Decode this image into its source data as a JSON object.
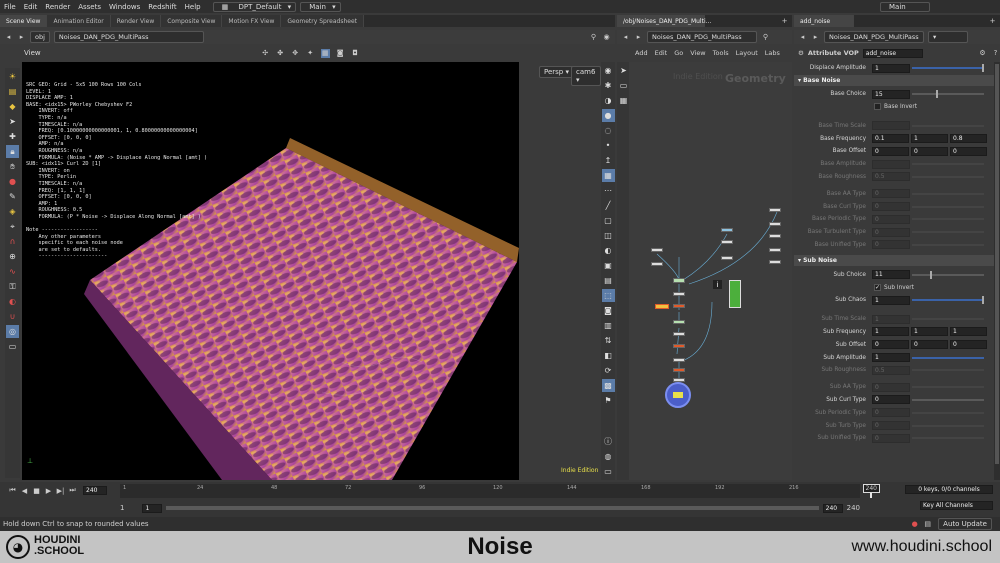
{
  "menu": [
    "File",
    "Edit",
    "Render",
    "Assets",
    "Windows",
    "Redshift",
    "Help"
  ],
  "desktop": {
    "name": "DPT_Default",
    "main": "Main"
  },
  "top_right_main": "Main",
  "left_tabs": [
    "Scene View",
    "Animation Editor",
    "Render View",
    "Composite View",
    "Motion FX View",
    "Geometry Spreadsheet"
  ],
  "left_path": {
    "obj": "obj",
    "node": "Noises_DAN_PDG_MultiPass"
  },
  "view_label": "View",
  "viewport": {
    "camera": "Persp",
    "cam_menu": "cam6",
    "watermark": "Indie Edition",
    "info_lines": [
      "SRC GEO: Grid - 5x5 100 Rows 100 Cols",
      "LEVEL: 1",
      "DISPLACE AMP: 1",
      "BASE: <idx15> PWorley Chebyshev F2",
      "    INVERT: off",
      "    TYPE: n/a",
      "    TIMESCALE: n/a",
      "    FREQ: [0.10000000000000001, 1, 0.80000000000000004]",
      "    OFFSET: [0, 0, 0]",
      "    AMP: n/a",
      "    ROUGHNESS: n/a",
      "    FORMULA: (Noise * AMP -> Displace Along Normal [amt] )",
      "SUB: <idx11> Curl 2D [1]",
      "    INVERT: on",
      "    TYPE: Perlin",
      "    TIMESCALE: n/a",
      "    FREQ: [1, 1, 1]",
      "    OFFSET: [0, 0, 0]",
      "    AMP: 1",
      "    ROUGHNESS: 0.5",
      "    FORMULA: (P * Noise -> Displace Along Normal [amt] )",
      "",
      "Note ------------------",
      "    Any other parameters",
      "    specific to each noise node",
      "    are set to defaults.",
      "    ----------------------"
    ]
  },
  "network": {
    "tab": "/obj/Noises_DAN_PDG_Multi...",
    "path_node": "Noises_DAN_PDG_MultiPass",
    "menu": [
      "Add",
      "Edit",
      "Go",
      "View",
      "Tools",
      "Layout",
      "Labs"
    ],
    "context_label": "Geometry",
    "watermark": "Indie Edition"
  },
  "parms": {
    "tab": "add_noise",
    "path_node": "Noises_DAN_PDG_MultiPass",
    "node_type": "Attribute VOP",
    "node_name": "add_noise",
    "displace_amplitude": {
      "label": "Displace Amplitude",
      "value": "1"
    },
    "base_section": "Base Noise",
    "base_choice": {
      "label": "Base Choice",
      "value": "15"
    },
    "base_invert": "Base Invert",
    "base_rows": [
      {
        "label": "Base Time Scale",
        "dim": true,
        "values": [
          ""
        ]
      },
      {
        "label": "Base Frequency",
        "dim": false,
        "values": [
          "0.1",
          "1",
          "0.8"
        ]
      },
      {
        "label": "Base Offset",
        "dim": false,
        "values": [
          "0",
          "0",
          "0"
        ]
      },
      {
        "label": "Base Amplitude",
        "dim": true,
        "values": [
          ""
        ]
      },
      {
        "label": "Base Roughness",
        "dim": true,
        "values": [
          "0.5"
        ]
      },
      {
        "label": "Base AA Type",
        "dim": true,
        "values": [
          "0"
        ]
      },
      {
        "label": "Base Curl Type",
        "dim": true,
        "values": [
          "0"
        ]
      },
      {
        "label": "Base Periodic Type",
        "dim": true,
        "values": [
          "0"
        ]
      },
      {
        "label": "Base Turbulent Type",
        "dim": true,
        "values": [
          "0"
        ]
      },
      {
        "label": "Base Unified Type",
        "dim": true,
        "values": [
          "0"
        ]
      }
    ],
    "sub_section": "Sub Noise",
    "sub_choice": {
      "label": "Sub Choice",
      "value": "11"
    },
    "sub_invert": "Sub Invert",
    "sub_chaos": {
      "label": "Sub Chaos",
      "value": "1"
    },
    "sub_rows": [
      {
        "label": "Sub Time Scale",
        "dim": true,
        "values": [
          "1"
        ]
      },
      {
        "label": "Sub Frequency",
        "dim": false,
        "values": [
          "1",
          "1",
          "1"
        ]
      },
      {
        "label": "Sub Offset",
        "dim": false,
        "values": [
          "0",
          "0",
          "0"
        ]
      },
      {
        "label": "Sub Amplitude",
        "dim": false,
        "values": [
          "1"
        ]
      },
      {
        "label": "Sub Roughness",
        "dim": true,
        "values": [
          "0.5"
        ]
      },
      {
        "label": "Sub AA Type",
        "dim": true,
        "values": [
          "0"
        ]
      },
      {
        "label": "Sub Curl Type",
        "dim": false,
        "values": [
          "0"
        ]
      },
      {
        "label": "Sub Periodic Type",
        "dim": true,
        "values": [
          "0"
        ]
      },
      {
        "label": "Sub Turb Type",
        "dim": true,
        "values": [
          "0"
        ]
      },
      {
        "label": "Sub Unified Type",
        "dim": true,
        "values": [
          "0"
        ]
      }
    ]
  },
  "timeline": {
    "current_frame": "240",
    "ticks": [
      "1",
      "24",
      "48",
      "72",
      "96",
      "120",
      "144",
      "168",
      "192",
      "216"
    ],
    "end_marker": "240",
    "range_start": "1",
    "range_start2": "1",
    "range_end": "240",
    "range_end2": "240",
    "keys": "0 keys, 0/0 channels",
    "key_all": "Key All Channels",
    "auto_update": "Auto Update",
    "status": "Hold down Ctrl to snap to rounded values"
  },
  "footer": {
    "logo_line1": "HOUDINI",
    "logo_line2": ".SCHOOL",
    "title": "Noise",
    "url": "www.houdini.school"
  },
  "colors": {
    "surface_light": "#e0a53a",
    "surface_mid": "#b04aa0",
    "surface_dark": "#3b1a3f",
    "wire_blue": "#6ab0d8",
    "network_bg": "#3c3c3c"
  }
}
